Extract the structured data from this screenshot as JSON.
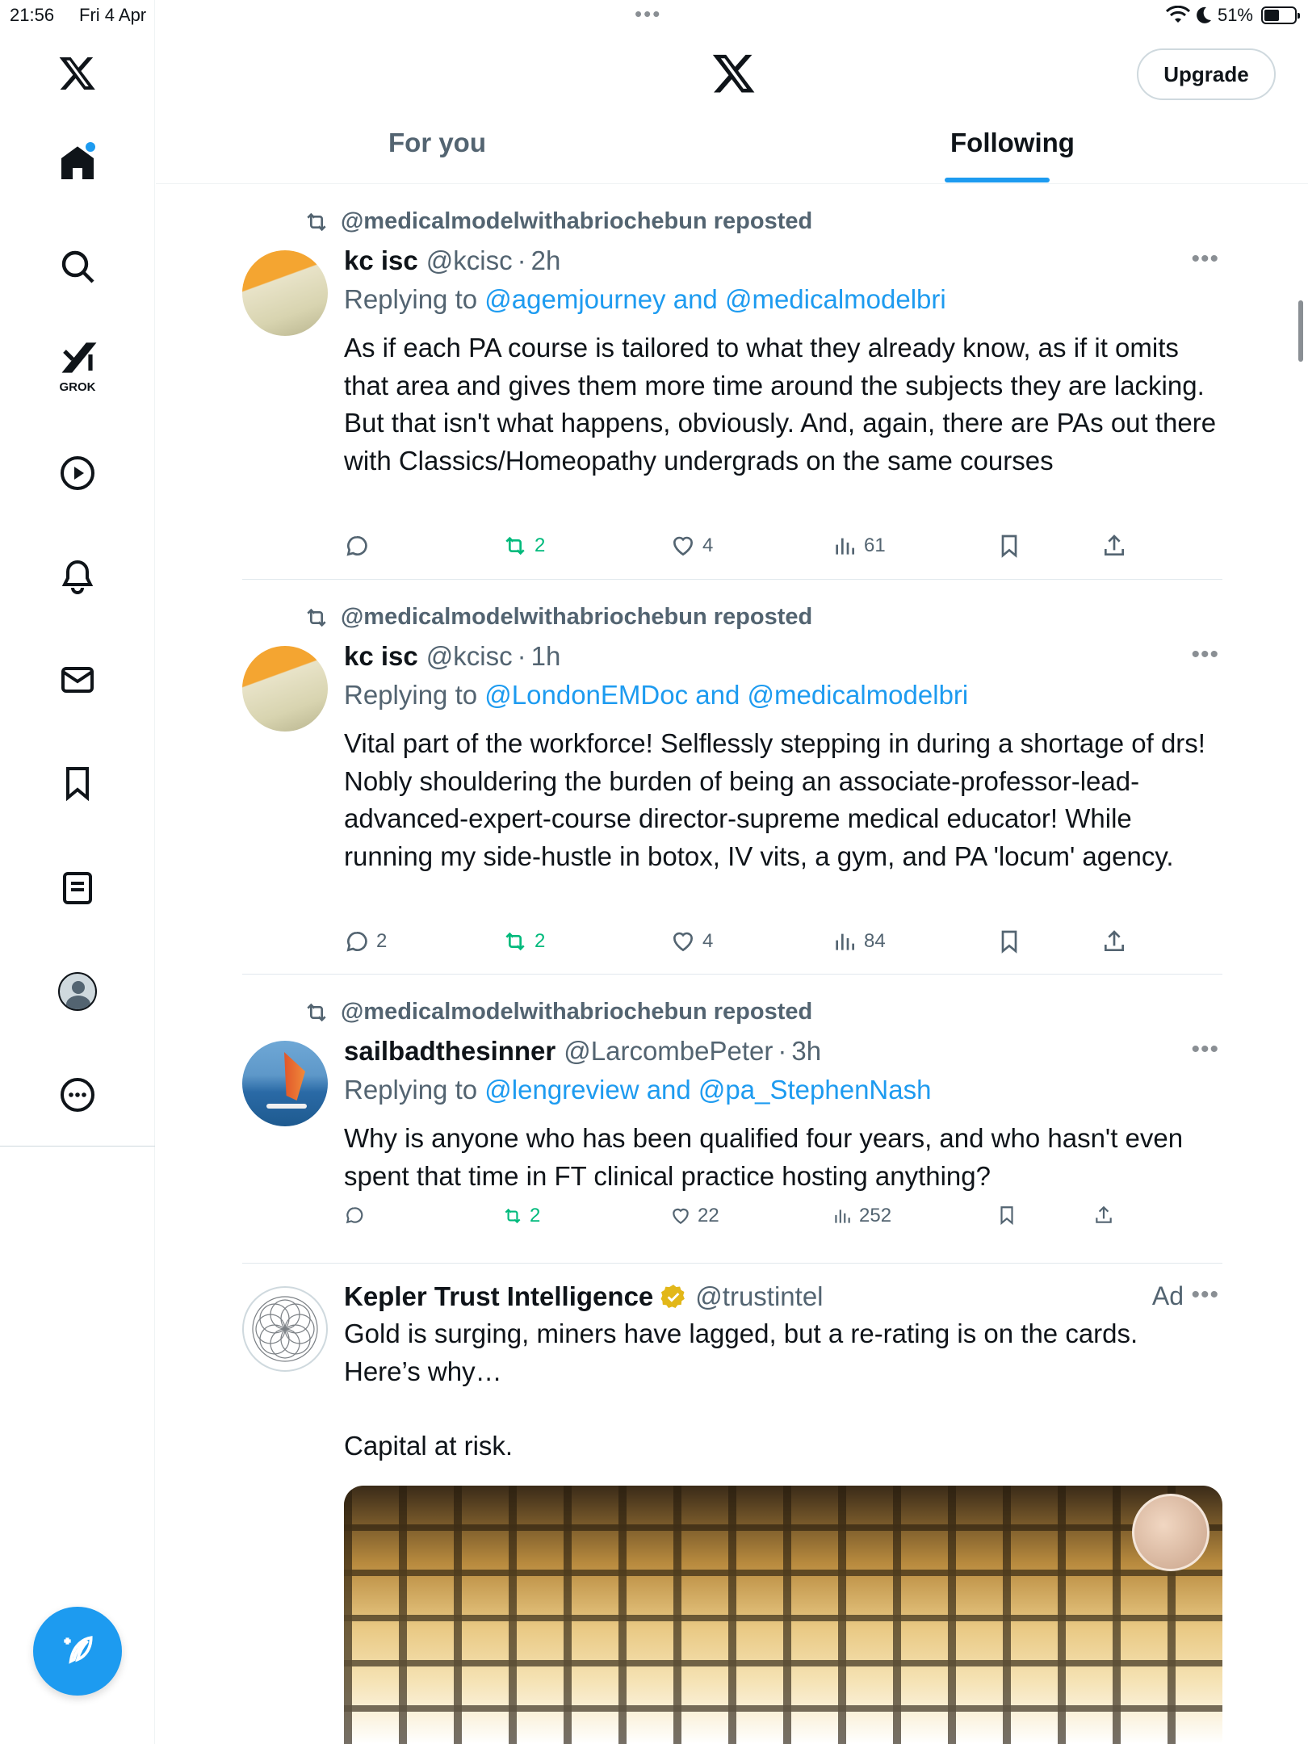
{
  "status_bar": {
    "time": "21:56",
    "date": "Fri 4 Apr",
    "battery": "51%",
    "battery_level": 0.51
  },
  "header": {
    "upgrade_label": "Upgrade",
    "tabs": [
      {
        "label": "For you",
        "active": false
      },
      {
        "label": "Following",
        "active": true
      }
    ]
  },
  "sidebar": {
    "items": [
      {
        "icon": "x-logo-icon"
      },
      {
        "icon": "home-icon",
        "notification": true
      },
      {
        "icon": "search-icon"
      },
      {
        "icon": "grok-icon",
        "label": "GROK"
      },
      {
        "icon": "video-icon"
      },
      {
        "icon": "notifications-icon"
      },
      {
        "icon": "messages-icon"
      },
      {
        "icon": "bookmarks-icon"
      },
      {
        "icon": "lists-icon"
      },
      {
        "icon": "profile-icon"
      },
      {
        "icon": "more-icon"
      }
    ],
    "compose_icon": "compose-post-icon"
  },
  "posts": [
    {
      "repost_by": "@medicalmodelwithabriochebun reposted",
      "name": "kc isc",
      "handle": "@kcisc",
      "time": "2h",
      "replying_prefix": "Replying to",
      "replying_to": "@agemjourney and @medicalmodelbri",
      "text": "As if each PA course is tailored to what they already know, as if it omits that area and gives them more time around the subjects they are lacking. But that isn't what happens, obviously. And, again, there are PAs out there with Classics/Homeopathy undergrads on the same courses",
      "replies": "",
      "reposts": "2",
      "likes": "4",
      "views": "61"
    },
    {
      "repost_by": "@medicalmodelwithabriochebun reposted",
      "name": "kc isc",
      "handle": "@kcisc",
      "time": "1h",
      "replying_prefix": "Replying to",
      "replying_to": "@LondonEMDoc and @medicalmodelbri",
      "text": "Vital part of the workforce! Selflessly stepping in during a shortage of drs! Nobly shouldering the burden of being an associate-professor-lead-advanced-expert-course director-supreme medical educator! While running my side-hustle in botox, IV vits, a gym, and PA 'locum' agency.",
      "replies": "2",
      "reposts": "2",
      "likes": "4",
      "views": "84"
    },
    {
      "repost_by": "@medicalmodelwithabriochebun reposted",
      "name": "sailbadthesinner",
      "handle": "@LarcombePeter",
      "time": "3h",
      "replying_prefix": "Replying to",
      "replying_to": "@lengreview and @pa_StephenNash",
      "text": "Why is anyone who has been qualified four years, and who hasn't even spent that time in FT clinical practice hosting anything?",
      "replies": "",
      "reposts": "2",
      "likes": "22",
      "views": "252"
    },
    {
      "name": "Kepler Trust Intelligence",
      "handle": "@trustintel",
      "ad_label": "Ad",
      "text_line1": "Gold is surging, miners have lagged, but a re-rating is on the cards.",
      "text_line2": "Here’s why…",
      "text_line3": "Capital at risk."
    }
  ],
  "colors": {
    "accent": "#1d9bf0",
    "repost_green": "#00ba7c",
    "secondary_text": "#536471",
    "primary_text": "#0f1419"
  }
}
